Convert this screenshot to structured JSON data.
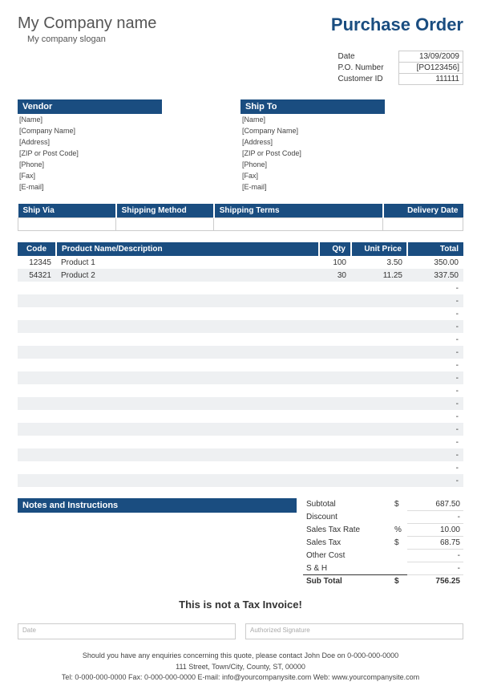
{
  "company": {
    "name": "My Company name",
    "slogan": "My company slogan"
  },
  "title": "Purchase Order",
  "meta": {
    "date_label": "Date",
    "date_value": "13/09/2009",
    "po_label": "P.O. Number",
    "po_value": "[PO123456]",
    "cust_label": "Customer ID",
    "cust_value": "111111"
  },
  "vendor": {
    "header": "Vendor",
    "lines": [
      "[Name]",
      "[Company Name]",
      "[Address]",
      "[ZIP or Post Code]",
      "[Phone]",
      "[Fax]",
      "[E-mail]"
    ]
  },
  "shipto": {
    "header": "Ship To",
    "lines": [
      "[Name]",
      "[Company Name]",
      "[Address]",
      "[ZIP or Post Code]",
      "[Phone]",
      "[Fax]",
      "[E-mail]"
    ]
  },
  "ship": {
    "h1": "Ship Via",
    "h2": "Shipping Method",
    "h3": "Shipping Terms",
    "h4": "Delivery Date",
    "v1": "",
    "v2": "",
    "v3": "",
    "v4": ""
  },
  "items": {
    "h_code": "Code",
    "h_desc": "Product Name/Description",
    "h_qty": "Qty",
    "h_price": "Unit Price",
    "h_total": "Total",
    "rows": [
      {
        "code": "12345",
        "desc": "Product 1",
        "qty": "100",
        "price": "3.50",
        "total": "350.00"
      },
      {
        "code": "54321",
        "desc": "Product 2",
        "qty": "30",
        "price": "11.25",
        "total": "337.50"
      },
      {
        "code": "",
        "desc": "",
        "qty": "",
        "price": "",
        "total": "-"
      },
      {
        "code": "",
        "desc": "",
        "qty": "",
        "price": "",
        "total": "-"
      },
      {
        "code": "",
        "desc": "",
        "qty": "",
        "price": "",
        "total": "-"
      },
      {
        "code": "",
        "desc": "",
        "qty": "",
        "price": "",
        "total": "-"
      },
      {
        "code": "",
        "desc": "",
        "qty": "",
        "price": "",
        "total": "-"
      },
      {
        "code": "",
        "desc": "",
        "qty": "",
        "price": "",
        "total": "-"
      },
      {
        "code": "",
        "desc": "",
        "qty": "",
        "price": "",
        "total": "-"
      },
      {
        "code": "",
        "desc": "",
        "qty": "",
        "price": "",
        "total": "-"
      },
      {
        "code": "",
        "desc": "",
        "qty": "",
        "price": "",
        "total": "-"
      },
      {
        "code": "",
        "desc": "",
        "qty": "",
        "price": "",
        "total": "-"
      },
      {
        "code": "",
        "desc": "",
        "qty": "",
        "price": "",
        "total": "-"
      },
      {
        "code": "",
        "desc": "",
        "qty": "",
        "price": "",
        "total": "-"
      },
      {
        "code": "",
        "desc": "",
        "qty": "",
        "price": "",
        "total": "-"
      },
      {
        "code": "",
        "desc": "",
        "qty": "",
        "price": "",
        "total": "-"
      },
      {
        "code": "",
        "desc": "",
        "qty": "",
        "price": "",
        "total": "-"
      },
      {
        "code": "",
        "desc": "",
        "qty": "",
        "price": "",
        "total": "-"
      }
    ]
  },
  "notes_header": "Notes and Instructions",
  "totals": {
    "subtotal_l": "Subtotal",
    "subtotal_v": "687.50",
    "discount_l": "Discount",
    "discount_v": "-",
    "taxrate_l": "Sales Tax Rate",
    "taxrate_v": "10.00",
    "tax_l": "Sales Tax",
    "tax_v": "68.75",
    "other_l": "Other Cost",
    "other_v": "-",
    "sh_l": "S & H",
    "sh_v": "-",
    "grand_l": "Sub Total",
    "grand_v": "756.25",
    "currency": "$",
    "percent": "%"
  },
  "notice": "This is not a Tax Invoice!",
  "sig": {
    "date": "Date",
    "auth": "Authorized Signature"
  },
  "footer": {
    "l1": "Should you have any enquiries concerning this quote, please contact John Doe on 0-000-000-0000",
    "l2": "111 Street, Town/City, County, ST, 00000",
    "l3": "Tel: 0-000-000-0000 Fax: 0-000-000-0000 E-mail: info@yourcompanysite.com Web: www.yourcompanysite.com"
  }
}
